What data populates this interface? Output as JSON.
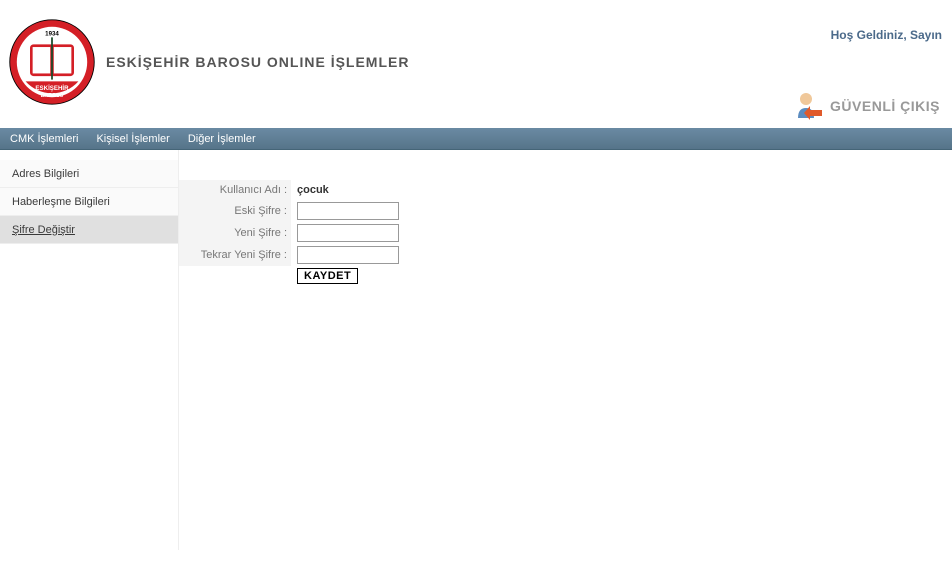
{
  "header": {
    "site_title": "ESKİŞEHİR BAROSU ONLINE İŞLEMLER",
    "logo_year": "1934",
    "logo_text_top": "ESKİŞEHİR",
    "logo_text_bot": "BAROSU",
    "welcome": "Hoş Geldiniz, Sayın",
    "logout_label": "GÜVENLİ ÇIKIŞ"
  },
  "menubar": {
    "items": [
      {
        "label": "CMK İşlemleri"
      },
      {
        "label": "Kişisel İşlemler"
      },
      {
        "label": "Diğer İşlemler"
      }
    ]
  },
  "sidebar": {
    "items": [
      {
        "label": "Adres Bilgileri",
        "active": false
      },
      {
        "label": "Haberleşme Bilgileri",
        "active": false
      },
      {
        "label": "Şifre Değiştir",
        "active": true
      }
    ]
  },
  "form": {
    "username_label": "Kullanıcı Adı :",
    "username_value": "çocuk",
    "old_password_label": "Eski Şifre :",
    "new_password_label": "Yeni Şifre :",
    "repeat_password_label": "Tekrar Yeni Şifre :",
    "save_label": "KAYDET"
  }
}
